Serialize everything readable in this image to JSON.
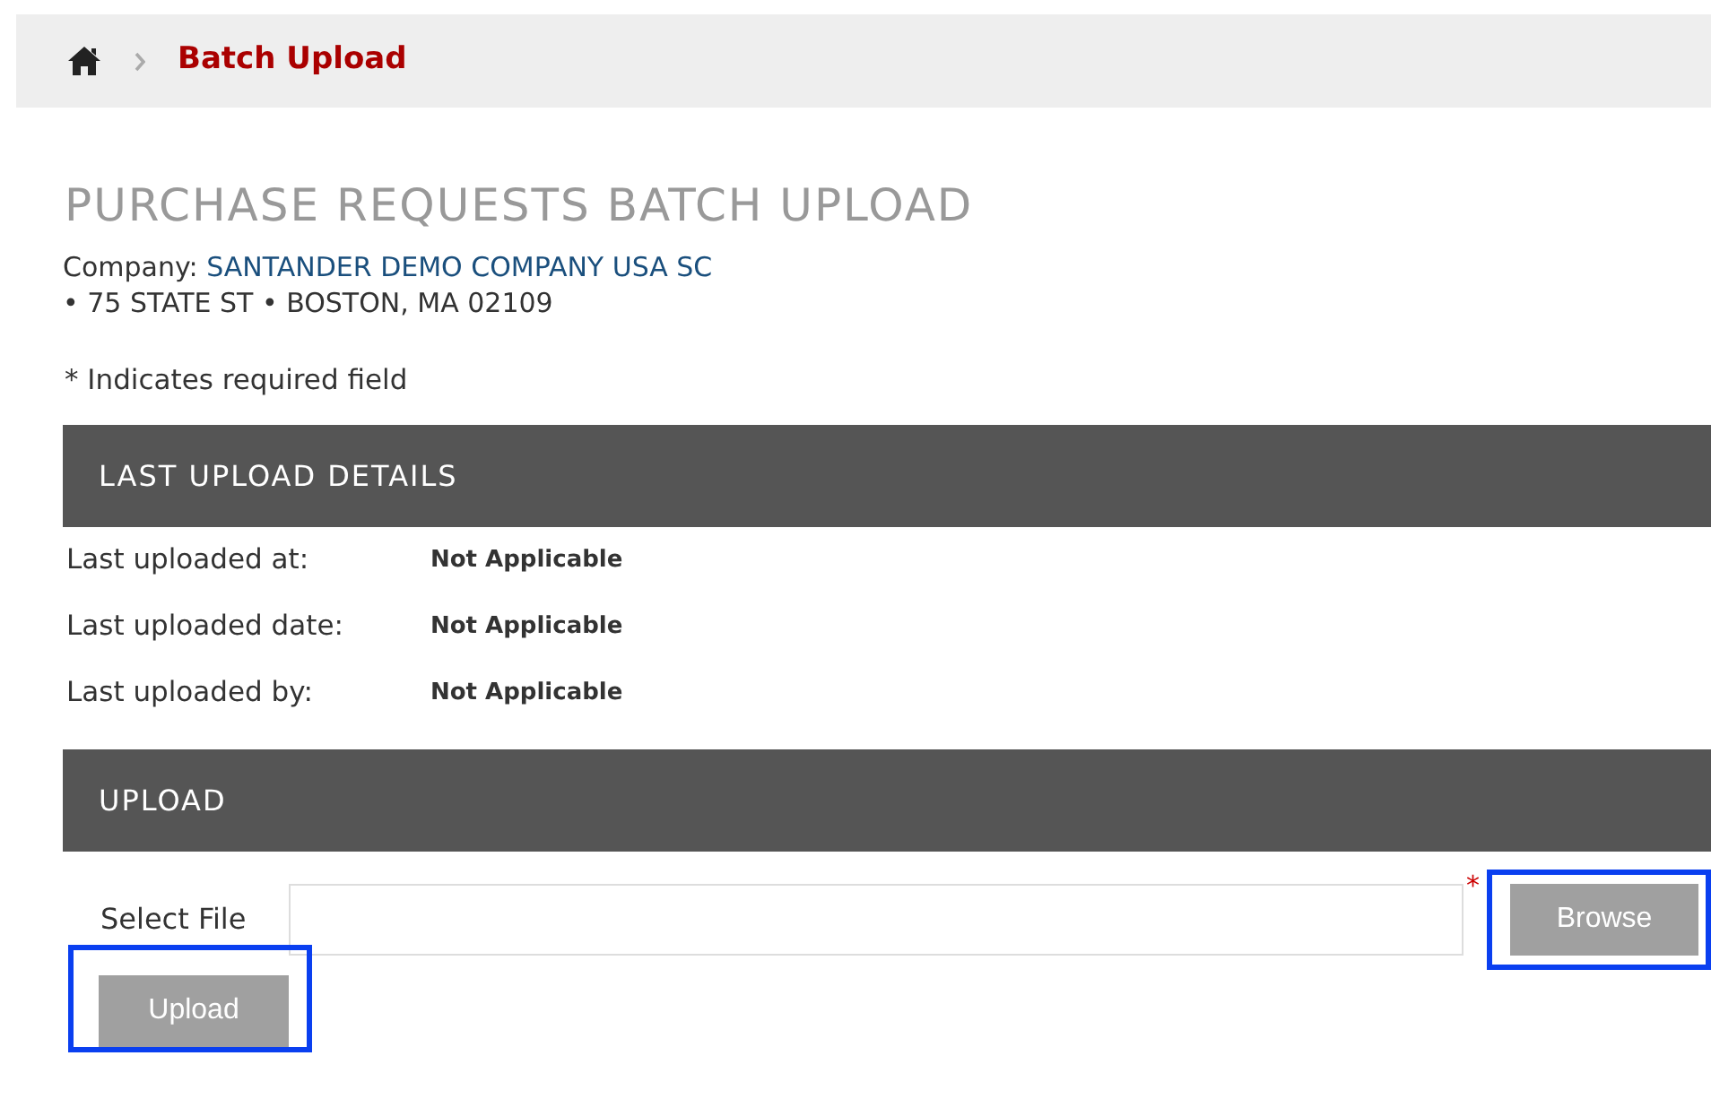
{
  "breadcrumb": {
    "current": "Batch Upload"
  },
  "page_title": "PURCHASE REQUESTS BATCH UPLOAD",
  "company": {
    "label": "Company:",
    "name": "SANTANDER DEMO COMPANY USA SC",
    "address": "• 75 STATE ST • BOSTON, MA 02109"
  },
  "required_note": "* Indicates required field",
  "last_upload": {
    "title": "LAST UPLOAD DETAILS",
    "fields": [
      {
        "label": "Last uploaded at:",
        "value": "Not Applicable"
      },
      {
        "label": "Last uploaded date:",
        "value": "Not Applicable"
      },
      {
        "label": "Last uploaded by:",
        "value": "Not Applicable"
      }
    ]
  },
  "upload": {
    "title": "UPLOAD",
    "file_label": "Select File",
    "required_mark": "*",
    "browse_button": {
      "label": "Browse",
      "highlighted": true
    },
    "upload_button": {
      "label": "Upload",
      "highlighted": true
    }
  }
}
